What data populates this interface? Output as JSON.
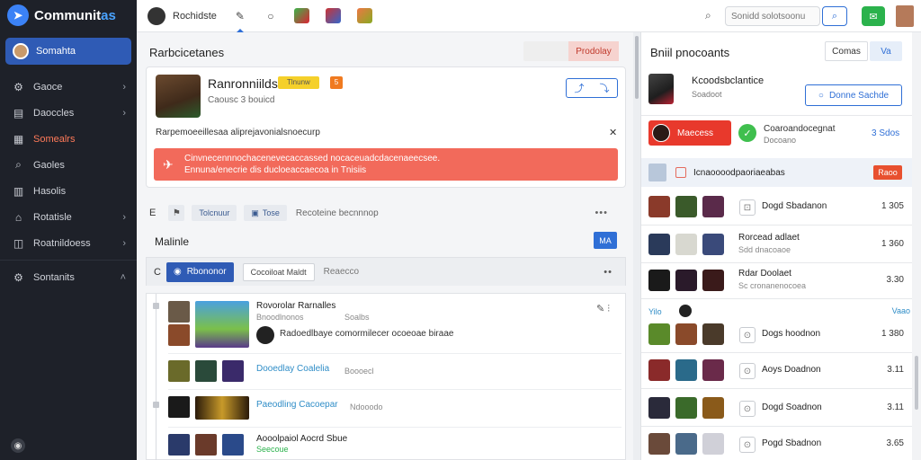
{
  "app": {
    "name_main": "Communit",
    "name_accent": "as"
  },
  "sidebar": {
    "active": {
      "label": "Somahta"
    },
    "items": [
      {
        "label": "Gaoce",
        "icon": "gamepad-icon",
        "chevron": true,
        "highlight": false
      },
      {
        "label": "Daoccles",
        "icon": "chart-icon",
        "chevron": true,
        "highlight": false
      },
      {
        "label": "Somealrs",
        "icon": "grid-icon",
        "chevron": false,
        "highlight": true
      },
      {
        "label": "Gaoles",
        "icon": "tag-icon",
        "chevron": false,
        "highlight": false
      },
      {
        "label": "Hasolis",
        "icon": "bars-icon",
        "chevron": false,
        "highlight": false
      },
      {
        "label": "Rotatisle",
        "icon": "home-icon",
        "chevron": true,
        "highlight": false
      },
      {
        "label": "Roatnildoess",
        "icon": "board-icon",
        "chevron": true,
        "highlight": false
      },
      {
        "label": "Sontanits",
        "icon": "gear-icon",
        "chevron": true,
        "highlight": false
      }
    ]
  },
  "topbar": {
    "user_label": "Rochidste",
    "search_placeholder": "Sonidd solotsoonu"
  },
  "center": {
    "title": "Rarbcicetanes",
    "title_button": "Prodolay",
    "profile": {
      "name": "Ranronniilds",
      "badge_yellow": "Tlnunw",
      "badge_orange": "5",
      "sub": "Caousc 3 bouicd"
    },
    "notice": "Rarpemoeeillesaa aliprejavonialsnoecurp",
    "alert": {
      "line1": "Cinvnecennnochacenevecaccassed nocaceuadcdacenaeecsee.",
      "line2": "Ennuna/enecrie dis ducloeaccaecoa in Tnisiis"
    },
    "filter": {
      "e": "E",
      "pill1": "Tolcnuur",
      "pill2": "Tose",
      "text": "Recoteine becnnnop"
    },
    "section_title": "Malinle",
    "section_button": "MA",
    "list_header": {
      "c": "C",
      "tab_active": "Rbononor",
      "tab2": "Cocoiloat Maldt",
      "text": "Reaecco"
    },
    "rows": [
      {
        "title": "Rovorolar Rarnalles",
        "sub": "Bnoodlnonos",
        "sub_right": "Soalbs",
        "line": "Radoedlbaye comormilecer ocoeoae biraae"
      },
      {
        "title": "Dooedlay Coalelia",
        "sub": "Boooecl"
      },
      {
        "title": "Paeodling Cacoepar",
        "sub": "Ndooodo"
      },
      {
        "title": "Aooolpaiol Aocrd Sbue",
        "sub": "Seecoue"
      }
    ]
  },
  "right": {
    "title": "Bniil pnocoants",
    "sel1": "Comas",
    "sel2": "Va",
    "user": {
      "name": "Kcoodsbclantice",
      "sub": "Soadoot"
    },
    "follow_label": "Donne Sachde",
    "red_label": "Maecess",
    "stat": {
      "title": "Coaroandocegnat",
      "sub": "Docoano",
      "value": "3 Sdos"
    },
    "band": {
      "text": "Icnaoooodpaoriaeabas",
      "button": "Raoo"
    },
    "rows": [
      {
        "name": "Dogd Sbadanon",
        "value": "1 305",
        "two_line": false
      },
      {
        "name": "Rorcead adlaet",
        "sub": "Sdd dnacoaoe",
        "value": "1 360",
        "two_line": true
      },
      {
        "name": "Rdar Doolaet",
        "sub": "Sc cronanenocoea",
        "value": "3.30",
        "two_line": true
      },
      {
        "name": "Dogs hoodnon",
        "value": "1 380",
        "two_line": false
      },
      {
        "name": "Aoys Doadnon",
        "value": "3.11",
        "two_line": false
      },
      {
        "name": "Dogd Soadnon",
        "value": "3.11",
        "two_line": false
      },
      {
        "name": "Pogd Sbadnon",
        "value": "3.65",
        "two_line": false
      }
    ],
    "mini_label": "Yilo",
    "mini_right": "Vaao"
  }
}
